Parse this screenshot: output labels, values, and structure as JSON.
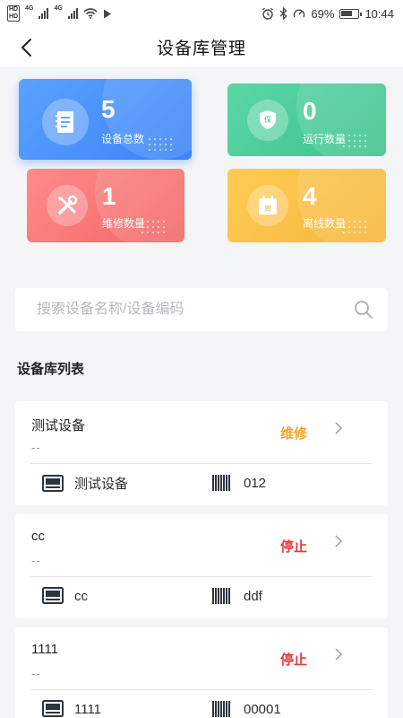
{
  "status_bar": {
    "battery_percent": "69%",
    "time": "10:44",
    "net_a": "4G",
    "net_b": "4G",
    "battery_level": 0.69
  },
  "header": {
    "title": "设备库管理"
  },
  "stats": {
    "total": {
      "value": "5",
      "label": "设备总数"
    },
    "running": {
      "value": "0",
      "label": "运行数量"
    },
    "repair": {
      "value": "1",
      "label": "维修数量"
    },
    "offline": {
      "value": "4",
      "label": "离线数量"
    },
    "offline_icon_text": "离",
    "running_icon_text": "保"
  },
  "search": {
    "placeholder": "搜索设备名称/设备编码",
    "value": ""
  },
  "list": {
    "title": "设备库列表",
    "items": [
      {
        "name": "测试设备",
        "sub": "--",
        "status": "维修",
        "status_color": "#f0a732",
        "type": "测试设备",
        "code": "012"
      },
      {
        "name": "cc",
        "sub": "--",
        "status": "停止",
        "status_color": "#e8383d",
        "type": "cc",
        "code": "ddf"
      },
      {
        "name": "1111",
        "sub": "--",
        "status": "停止",
        "status_color": "#e8383d",
        "type": "1111",
        "code": "00001"
      }
    ]
  },
  "colors": {
    "total": "#3b82f6",
    "running": "#3ec28c",
    "repair": "#f26565",
    "offline": "#f6b53a"
  }
}
